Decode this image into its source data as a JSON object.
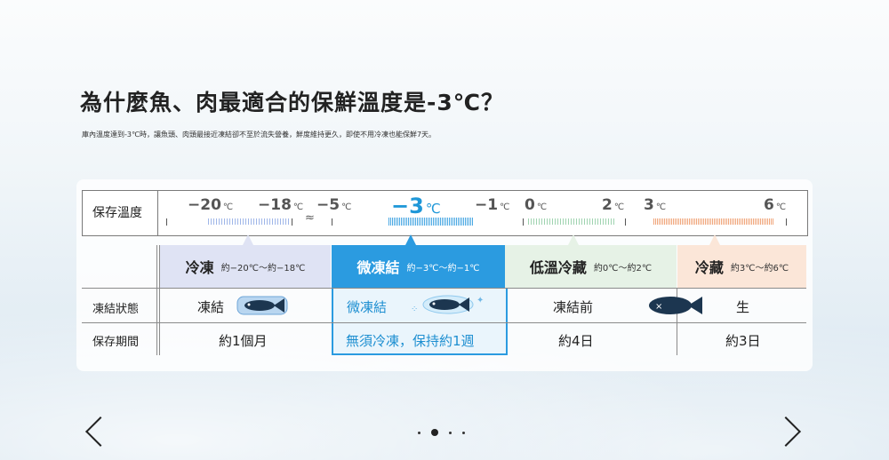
{
  "page": {
    "title": "為什麼魚、肉最適合的保鮮溫度是-3℃？",
    "subtitle": "庫內溫度達到-3℃時，讓魚頭、肉頭最接近凍結卻不至於流失營養，鮮度維持更久，即使不用冷凍也能保鮮7天。"
  },
  "scale": {
    "label": "保存溫度",
    "unit": "℃",
    "ticks": [
      {
        "value": "−20"
      },
      {
        "value": "−18"
      },
      {
        "value": "−5"
      },
      {
        "value": "−3"
      },
      {
        "value": "−1"
      },
      {
        "value": "0"
      },
      {
        "value": "2"
      },
      {
        "value": "3"
      },
      {
        "value": "6"
      }
    ],
    "break_symbol": "≈"
  },
  "columns": [
    {
      "name": "冷凍",
      "range": "約−20℃〜約−18℃",
      "bg": "#dfe3f4"
    },
    {
      "name": "微凍結",
      "range": "約−3℃〜約−1℃",
      "bg": "#2b9be0"
    },
    {
      "name": "低溫冷藏",
      "range": "約0℃〜約2℃",
      "bg": "#e6f2e6"
    },
    {
      "name": "冷藏",
      "range": "約3℃〜約6℃",
      "bg": "#fbe6d8"
    }
  ],
  "rows": [
    {
      "label": "凍結狀態",
      "cells": [
        "凍結",
        "微凍結",
        "凍結前",
        "生"
      ]
    },
    {
      "label": "保存期間",
      "cells": [
        "約1個月",
        "無須冷凍，保持約1週",
        "約4日",
        "約3日"
      ]
    }
  ],
  "pagination": {
    "total": 4,
    "current": 2
  },
  "colors": {
    "accent": "#1e97d8",
    "dark_fish": "#1c3650"
  }
}
